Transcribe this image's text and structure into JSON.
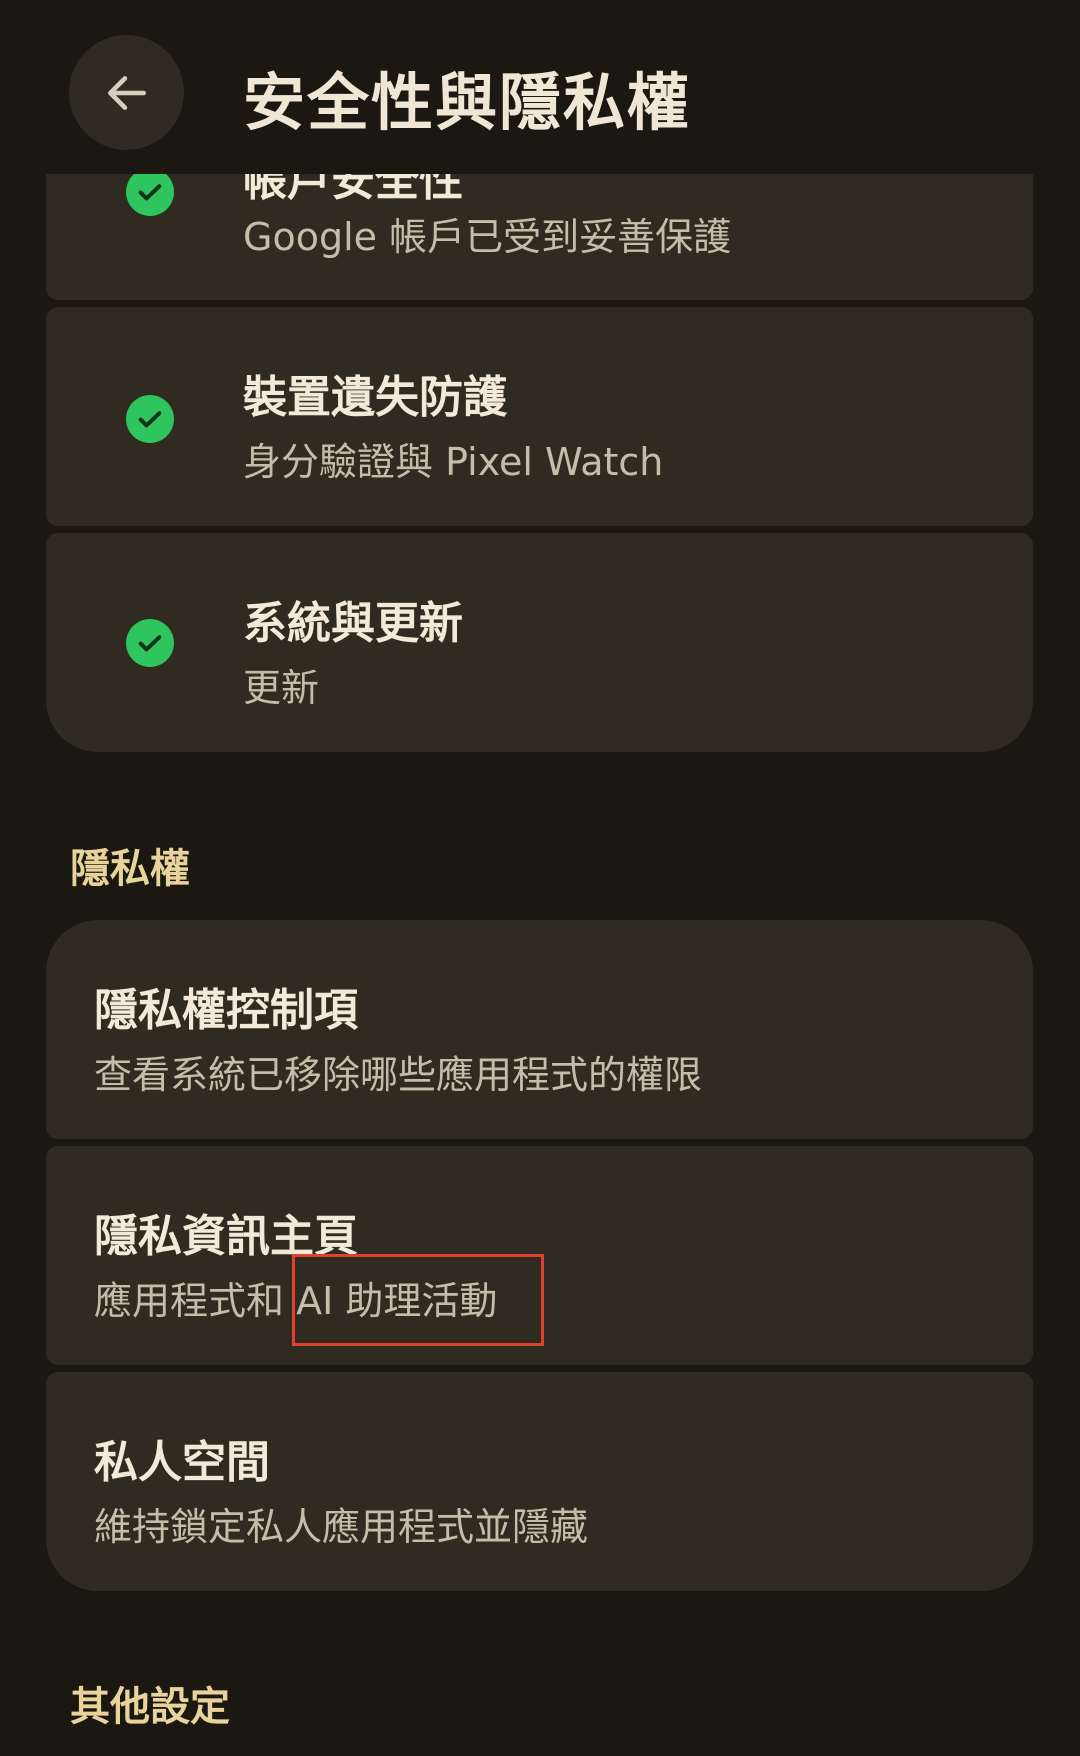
{
  "header": {
    "title": "安全性與隱私權",
    "back_icon": "arrow-back-icon"
  },
  "security_items": [
    {
      "title": "帳戶安全性",
      "subtitle": "Google 帳戶已受到妥善保護",
      "status_icon": "check-circle-icon"
    },
    {
      "title": "裝置遺失防護",
      "subtitle": "身分驗證與 Pixel Watch",
      "status_icon": "check-circle-icon"
    },
    {
      "title": "系統與更新",
      "subtitle": "更新",
      "status_icon": "check-circle-icon"
    }
  ],
  "privacy_section": {
    "header": "隱私權",
    "items": [
      {
        "title": "隱私權控制項",
        "subtitle": "查看系統已移除哪些應用程式的權限"
      },
      {
        "title": "隱私資訊主頁",
        "subtitle_prefix": "應用程式和",
        "subtitle_highlight": "AI 助理活動"
      },
      {
        "title": "私人空間",
        "subtitle": "維持鎖定私人應用程式並隱藏"
      }
    ]
  },
  "other_section": {
    "header": "其他設定"
  },
  "colors": {
    "background": "#1b1811",
    "card": "#302b20",
    "check_green": "#2ec55f",
    "section_header": "#e8d39a",
    "highlight_border": "#e0402e"
  }
}
